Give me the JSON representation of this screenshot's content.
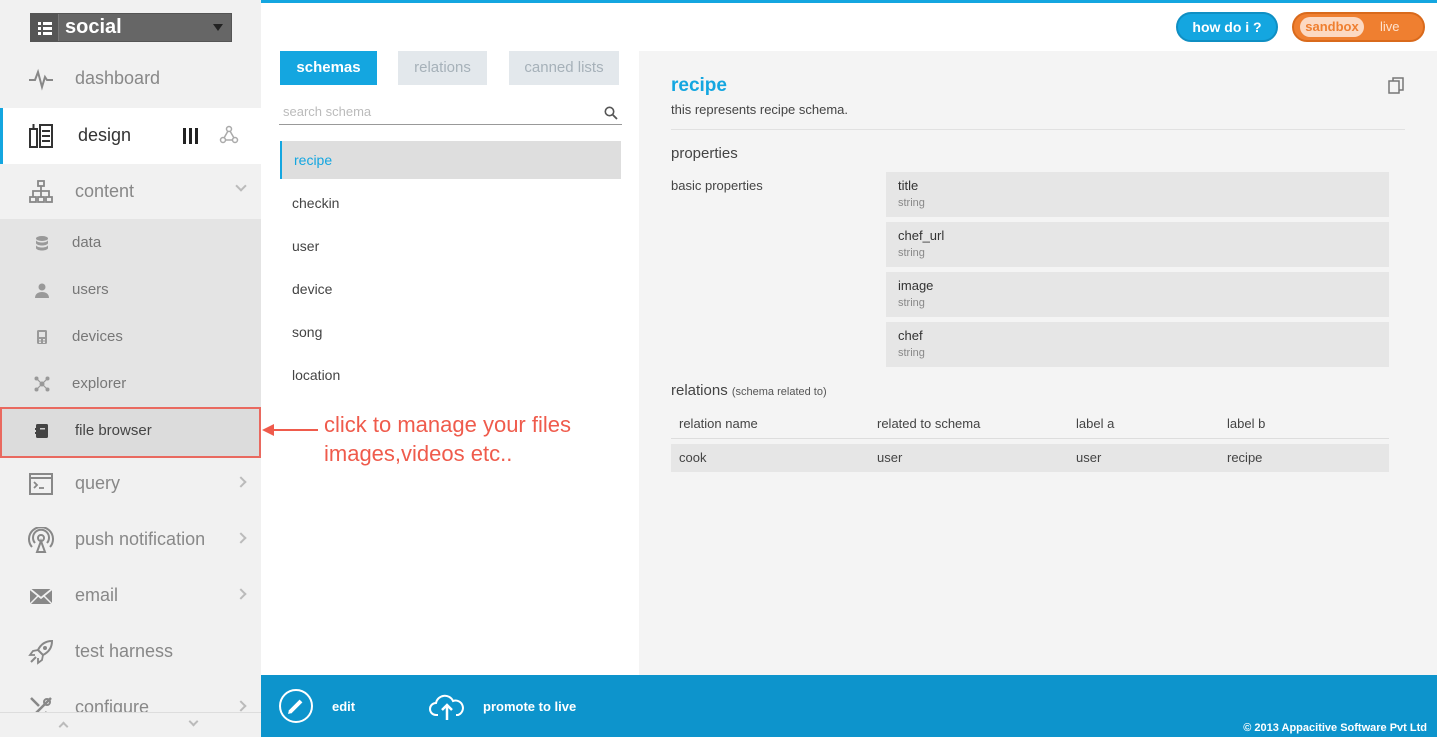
{
  "app_selector": {
    "name": "social"
  },
  "sidebar": {
    "items": [
      {
        "label": "dashboard"
      },
      {
        "label": "design"
      },
      {
        "label": "content"
      },
      {
        "label": "query"
      },
      {
        "label": "push notification"
      },
      {
        "label": "email"
      },
      {
        "label": "test harness"
      },
      {
        "label": "configure"
      }
    ],
    "content_sub": [
      {
        "label": "data"
      },
      {
        "label": "users"
      },
      {
        "label": "devices"
      },
      {
        "label": "explorer"
      },
      {
        "label": "file browser"
      }
    ]
  },
  "annotation": {
    "line1": "click to manage your files",
    "line2": "images,videos etc.."
  },
  "tabs": [
    {
      "label": "schemas",
      "active": true
    },
    {
      "label": "relations",
      "active": false
    },
    {
      "label": "canned lists",
      "active": false
    }
  ],
  "search": {
    "placeholder": "search schema",
    "value": ""
  },
  "schemas": [
    "recipe",
    "checkin",
    "user",
    "device",
    "song",
    "location"
  ],
  "detail": {
    "title": "recipe",
    "description": "this represents recipe schema.",
    "properties_heading": "properties",
    "basic_properties_label": "basic properties",
    "properties": [
      {
        "name": "title",
        "type": "string"
      },
      {
        "name": "chef_url",
        "type": "string"
      },
      {
        "name": "image",
        "type": "string"
      },
      {
        "name": "chef",
        "type": "string"
      }
    ],
    "relations_heading": "relations",
    "relations_sub": "(schema related to)",
    "relations_columns": [
      "relation name",
      "related to schema",
      "label a",
      "label b"
    ],
    "relations_rows": [
      [
        "cook",
        "user",
        "user",
        "recipe"
      ]
    ]
  },
  "header": {
    "howdoi": "how do i ?",
    "env_sandbox": "sandbox",
    "env_live": "live"
  },
  "footer": {
    "edit": "edit",
    "promote": "promote to live",
    "copyright": "© 2013 Appacitive Software Pvt Ltd"
  },
  "colors": {
    "accent": "#14a6e0",
    "annotation": "#ef5b4c",
    "env": "#ef7f30",
    "footer": "#0d94cc"
  }
}
